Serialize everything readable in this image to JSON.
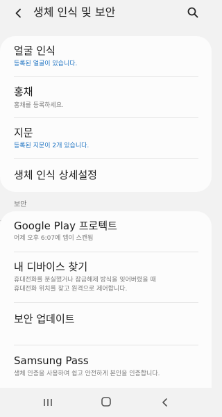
{
  "header": {
    "title": "생체 인식 및 보안",
    "back_icon": "chevron-left-icon",
    "search_icon": "search-icon"
  },
  "biometrics": {
    "items": [
      {
        "label": "얼굴 인식",
        "sub": "등록된 얼굴이 있습니다.",
        "sub_color": "#1f74c3"
      },
      {
        "label": "홍채",
        "sub": "홍채를 등록하세요.",
        "sub_color": "#7a7a7a"
      },
      {
        "label": "지문",
        "sub": "등록된 지문이 2개 있습니다.",
        "sub_color": "#1f74c3"
      },
      {
        "label": "생체 인식 상세설정"
      }
    ]
  },
  "security": {
    "section_label": "보안",
    "items": [
      {
        "label": "Google Play 프로텍트",
        "sub": "어제 오후 6:07에 앱이 스캔됨"
      },
      {
        "label": "내 디바이스 찾기",
        "sub_lines": [
          "휴대전화를 분실했거나 잠금해제 방식을 잊어버렸을 때",
          "휴대전화 위치를 찾고 원격으로 제어합니다."
        ]
      },
      {
        "label": "보안 업데이트"
      },
      {
        "label": "Samsung Pass",
        "sub": "생체 인증을 사용하여 쉽고 안전하게 본인을 인증합니다."
      }
    ]
  },
  "navbar": {
    "recents_icon": "recent-apps-icon",
    "home_icon": "home-icon",
    "back_icon": "back-icon"
  },
  "colors": {
    "background": "#f2f2f2",
    "card": "#fcfcfc",
    "accent_blue": "#1f74c3"
  }
}
